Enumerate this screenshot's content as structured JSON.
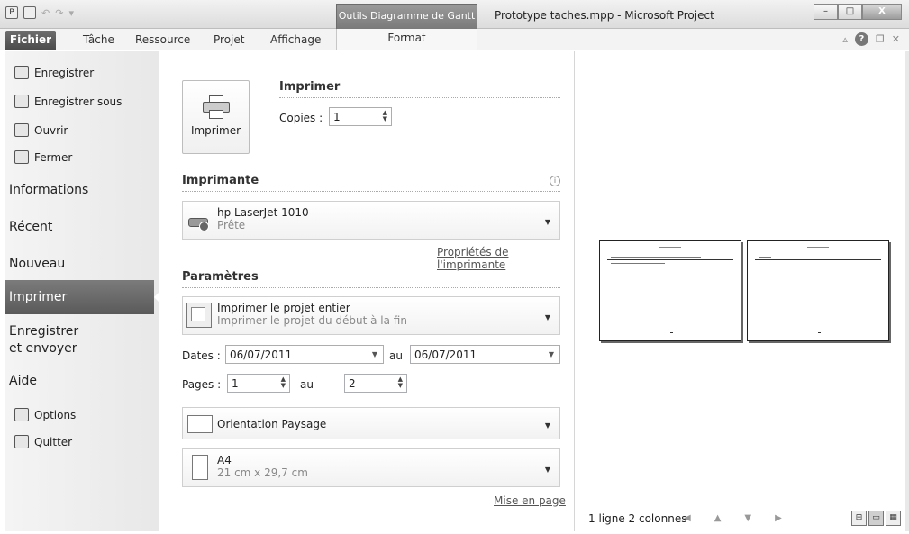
{
  "titlebar": {
    "context_tab": "Outils Diagramme de Gantt",
    "window_title": "Prototype taches.mpp - Microsoft Project",
    "app_icon": "P",
    "buttons": {
      "minimize": "–",
      "maximize": "□",
      "close": "X"
    }
  },
  "ribbon": {
    "tabs": [
      "Fichier",
      "Tâche",
      "Ressource",
      "Projet",
      "Affichage",
      "Format"
    ]
  },
  "leftnav": {
    "save": "Enregistrer",
    "save_as": "Enregistrer sous",
    "open": "Ouvrir",
    "close": "Fermer",
    "info": "Informations",
    "recent": "Récent",
    "new": "Nouveau",
    "print": "Imprimer",
    "send_line1": "Enregistrer",
    "send_line2": "et envoyer",
    "help": "Aide",
    "options": "Options",
    "quit": "Quitter"
  },
  "print": {
    "button_label": "Imprimer",
    "section_title": "Imprimer",
    "copies_label": "Copies :",
    "copies_value": "1"
  },
  "printer": {
    "section_title": "Imprimante",
    "name": "hp LaserJet 1010",
    "status": "Prête",
    "properties_link": "Propriétés de l'imprimante"
  },
  "settings": {
    "section_title": "Paramètres",
    "scope_title": "Imprimer le projet entier",
    "scope_desc": "Imprimer le projet du début à la fin",
    "dates_label": "Dates :",
    "date_from": "06/07/2011",
    "au_label": "au",
    "date_to": "06/07/2011",
    "pages_label": "Pages :",
    "page_from": "1",
    "page_to": "2",
    "orientation": "Orientation Paysage",
    "paper_size": "A4",
    "paper_dims": "21 cm x 29,7 cm",
    "page_setup_link": "Mise en page"
  },
  "preview": {
    "layout_label": "1 ligne 2 colonnes"
  }
}
